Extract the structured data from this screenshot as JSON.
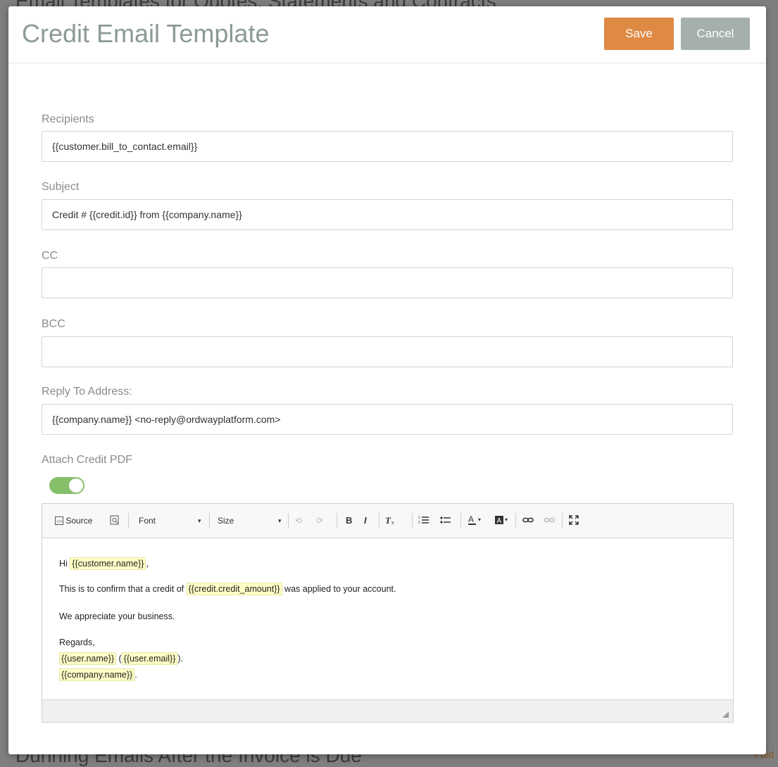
{
  "background": {
    "top_title": "Email Templates for Quotes, Statements and Contracts",
    "bottom_title": "Dunning Emails After the Invoice is Due",
    "bottom_right_badge": "Paid"
  },
  "modal": {
    "title": "Credit Email Template",
    "save_label": "Save",
    "cancel_label": "Cancel"
  },
  "fields": {
    "recipients": {
      "label": "Recipients",
      "value": "{{customer.bill_to_contact.email}}"
    },
    "subject": {
      "label": "Subject",
      "value": "Credit # {{credit.id}} from {{company.name}}"
    },
    "cc": {
      "label": "CC",
      "value": ""
    },
    "bcc": {
      "label": "BCC",
      "value": ""
    },
    "reply_to": {
      "label": "Reply To Address:",
      "value": "{{company.name}} <no-reply@ordwayplatform.com>"
    },
    "attach_pdf": {
      "label": "Attach Credit PDF",
      "enabled": true
    }
  },
  "toolbar": {
    "source_label": "Source",
    "font_label": "Font",
    "size_label": "Size",
    "bold_glyph": "B",
    "italic_glyph": "I"
  },
  "body": {
    "greeting_prefix": "Hi ",
    "customer_name": "{{customer.name}}",
    "greeting_suffix": ",",
    "confirm_prefix": "This is to confirm that a credit of ",
    "credit_amount": "{{credit.credit_amount}}",
    "confirm_suffix": " was applied to your account.",
    "appreciate": "We appreciate your business.",
    "regards": "Regards,",
    "user_name": "{{user.name}}",
    "paren_open": " (",
    "user_email": "{{user.email}}",
    "paren_close": ").",
    "company_name": "{{company.name}}",
    "period": "."
  },
  "colors": {
    "save": "#df8a44",
    "cancel": "#a5b0ac",
    "toggle_on": "#86bf6a",
    "title": "#8c9a94",
    "placeholder_bg": "#ffffc6"
  }
}
